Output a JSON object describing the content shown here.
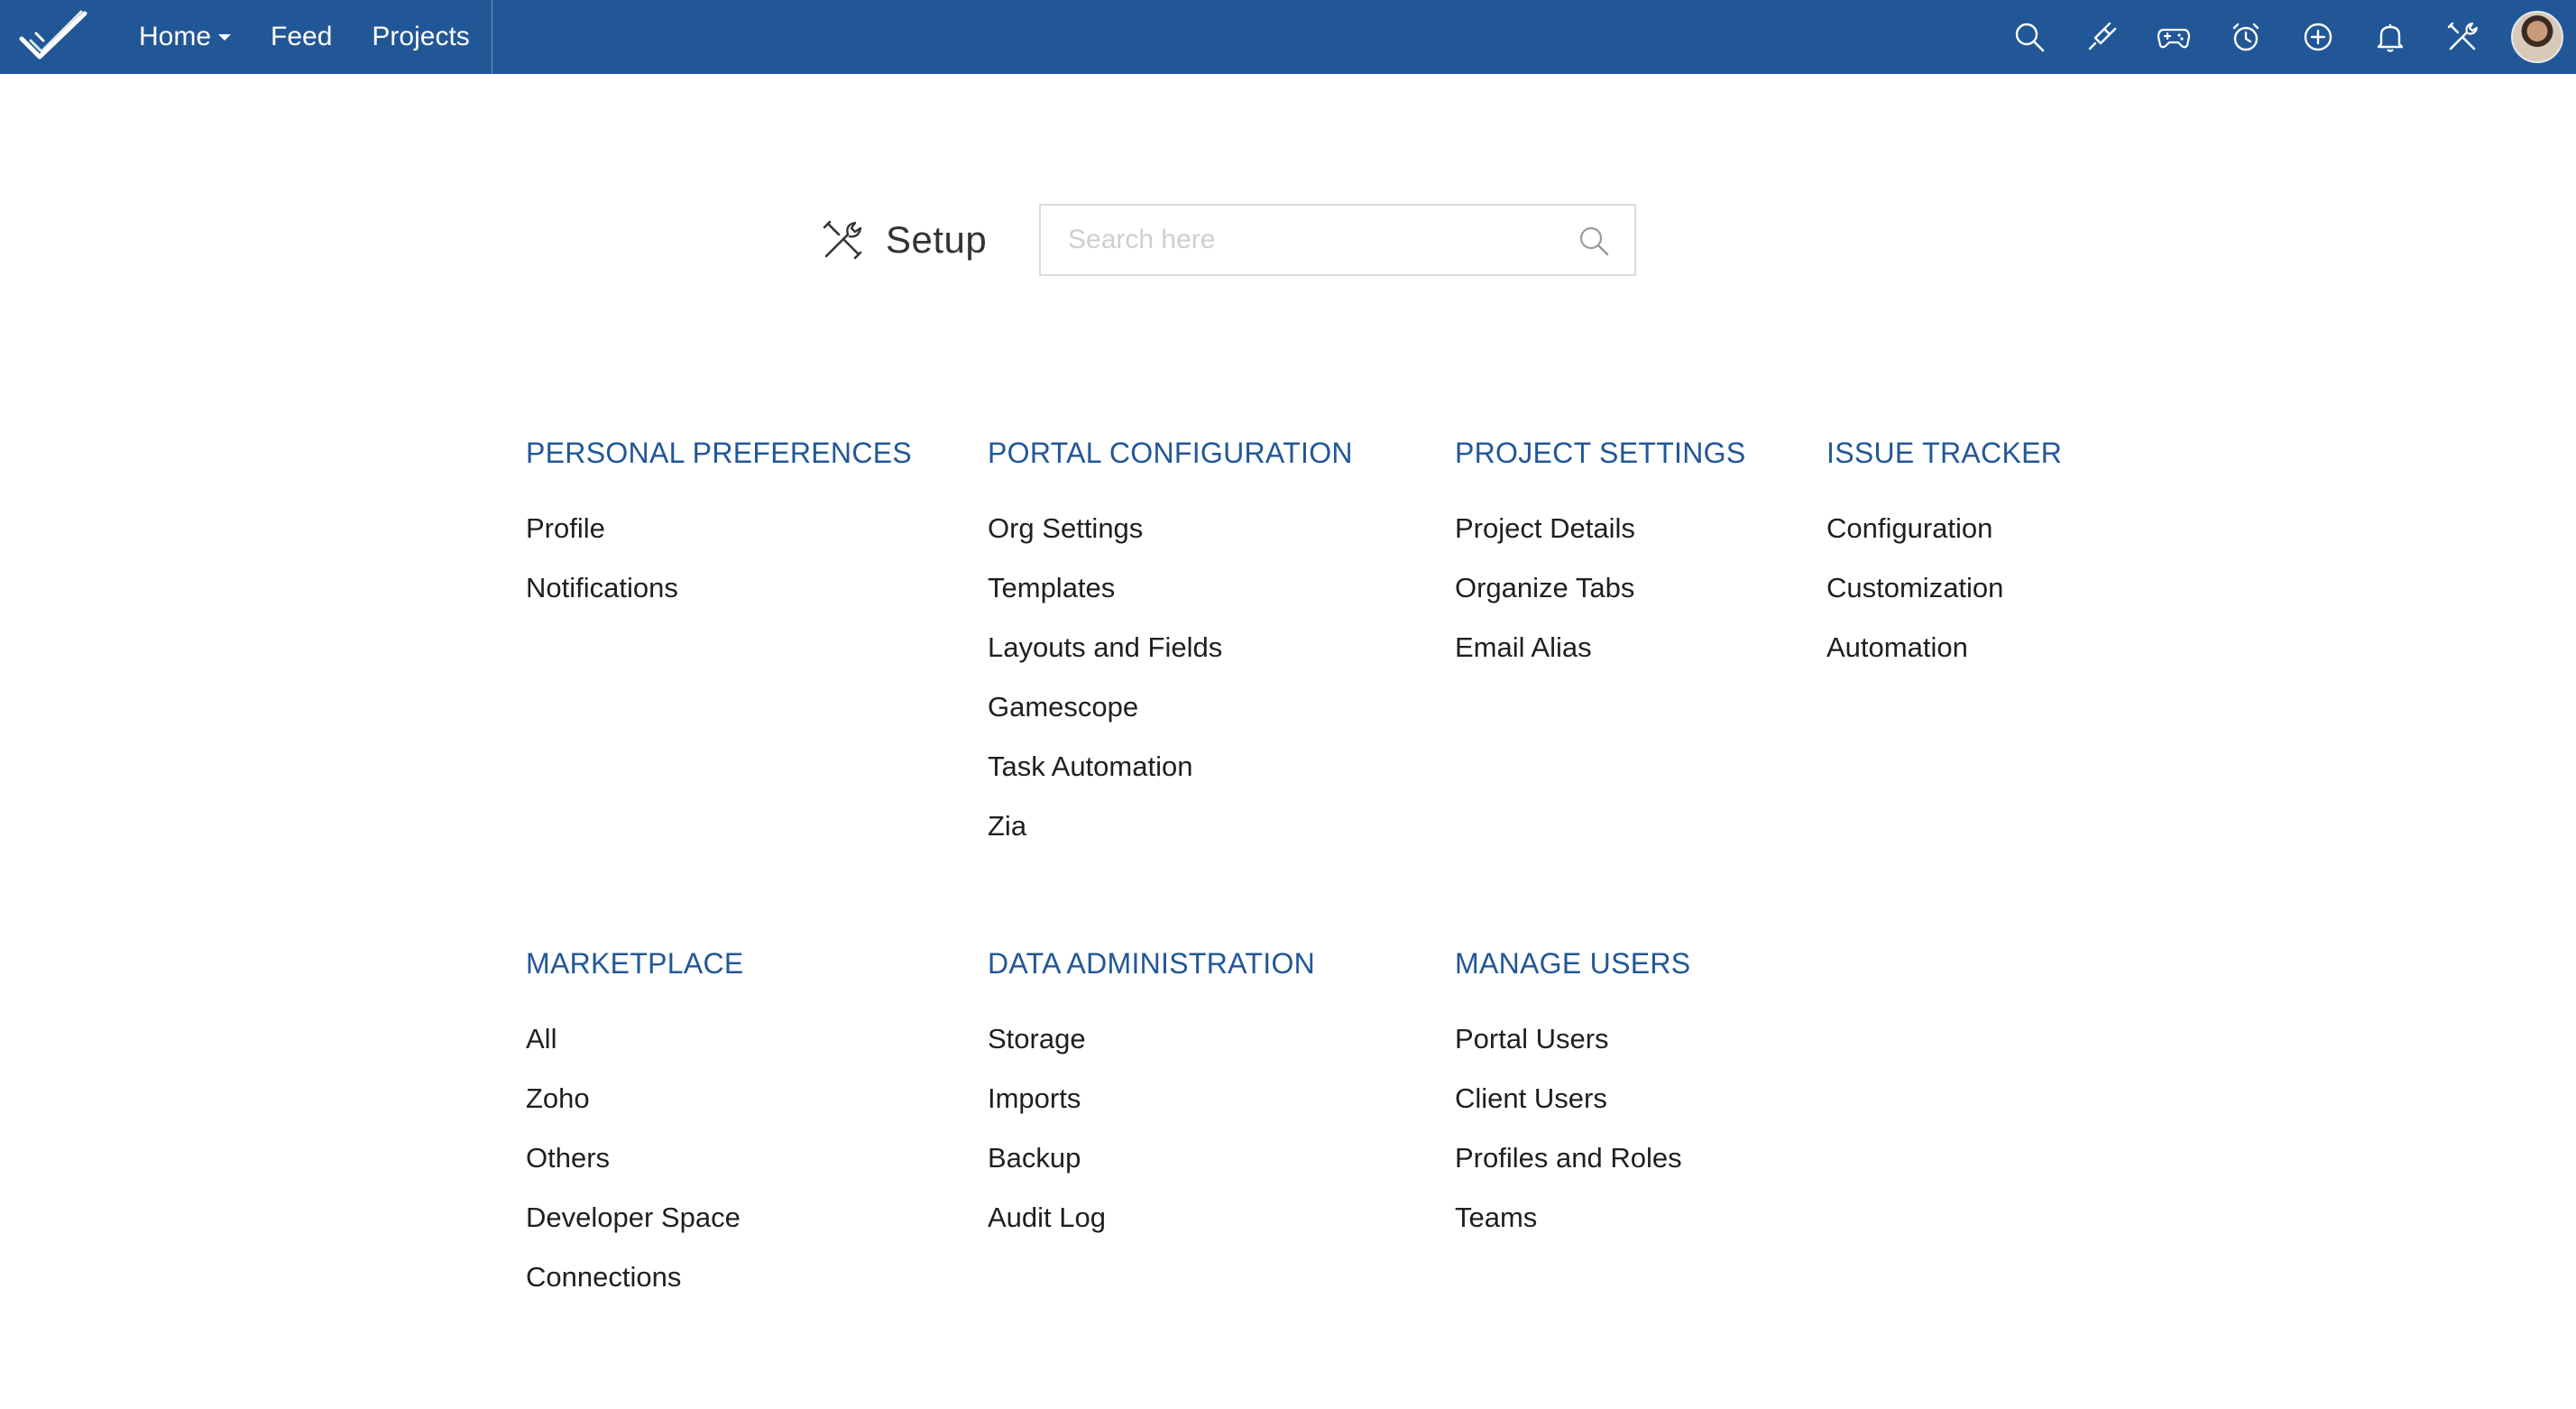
{
  "topbar": {
    "nav": [
      {
        "label": "Home",
        "has_caret": true
      },
      {
        "label": "Feed"
      },
      {
        "label": "Projects"
      }
    ],
    "icons": [
      "search-icon",
      "plugin-icon",
      "gamepad-icon",
      "timer-icon",
      "add-icon",
      "bell-icon",
      "tools-icon"
    ],
    "brand_color": "#225797"
  },
  "setup": {
    "title": "Setup",
    "search_placeholder": "Search here"
  },
  "sections": {
    "personal": {
      "title": "PERSONAL PREFERENCES",
      "items": [
        "Profile",
        "Notifications"
      ]
    },
    "portal": {
      "title": "PORTAL CONFIGURATION",
      "items": [
        "Org Settings",
        "Templates",
        "Layouts and Fields",
        "Gamescope",
        "Task Automation",
        "Zia"
      ]
    },
    "project": {
      "title": "PROJECT SETTINGS",
      "items": [
        "Project Details",
        "Organize Tabs",
        "Email Alias"
      ]
    },
    "issue": {
      "title": "ISSUE TRACKER",
      "items": [
        "Configuration",
        "Customization",
        "Automation"
      ]
    },
    "marketplace": {
      "title": "MARKETPLACE",
      "items": [
        "All",
        "Zoho",
        "Others",
        "Developer Space",
        "Connections"
      ]
    },
    "data": {
      "title": "DATA ADMINISTRATION",
      "items": [
        "Storage",
        "Imports",
        "Backup",
        "Audit Log"
      ]
    },
    "users": {
      "title": "MANAGE USERS",
      "items": [
        "Portal Users",
        "Client Users",
        "Profiles and Roles",
        "Teams"
      ]
    }
  }
}
